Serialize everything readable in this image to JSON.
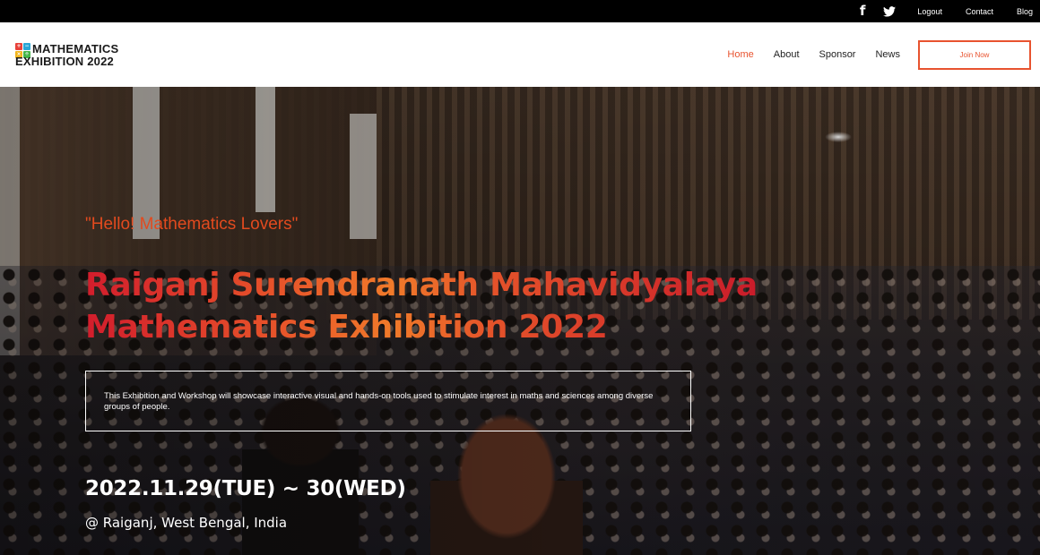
{
  "topbar": {
    "social_icons": [
      "facebook-icon",
      "twitter-icon"
    ],
    "links": [
      "Logout",
      "Contact",
      "Blog"
    ]
  },
  "logo": {
    "line1": "MATHEMATICS",
    "line2": "EXHIBITION 2022",
    "tiles": [
      {
        "symbol": "+",
        "color": "#e8413a"
      },
      {
        "symbol": "−",
        "color": "#2aa6d6"
      },
      {
        "symbol": "×",
        "color": "#f2b51c"
      },
      {
        "symbol": "÷",
        "color": "#45b649"
      }
    ]
  },
  "nav": {
    "items": [
      "Home",
      "About",
      "Sponsor",
      "News"
    ],
    "active": "Home",
    "join_label": "Join Now"
  },
  "hero": {
    "greeting": "\"Hello! Mathematics Lovers\"",
    "title_line1": "Raiganj Surendranath Mahavidyalaya",
    "title_line2": "Mathematics Exhibition 2022",
    "description": "This Exhibition and Workshop will showcase interactive visual and hands-on tools used to stimulate interest in maths and sciences among diverse groups of people.",
    "date": "2022.11.29(TUE) ~ 30(WED)",
    "venue": "@ Raiganj, West Bengal, India"
  },
  "colors": {
    "accent": "#e8532f",
    "title_gradient_start": "#d21d2c",
    "title_gradient_mid": "#f07a2a"
  }
}
